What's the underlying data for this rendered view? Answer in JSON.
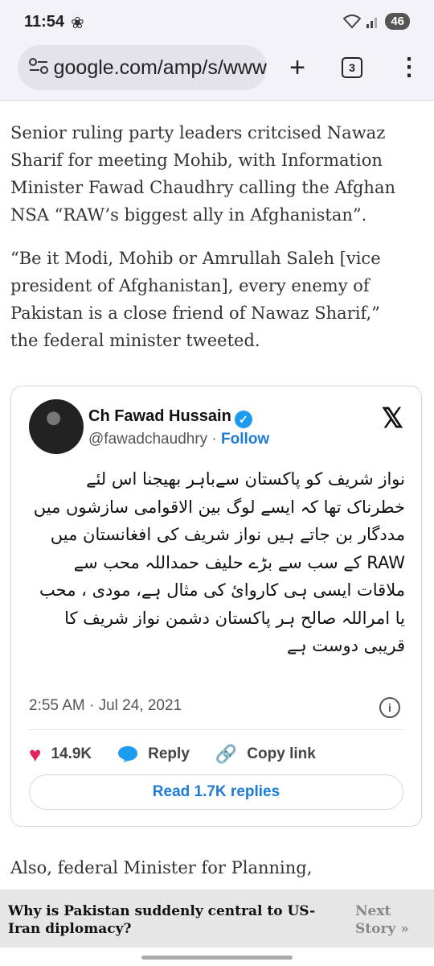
{
  "status_bar": {
    "time": "11:54",
    "battery": "46"
  },
  "browser": {
    "url": "google.com/amp/s/www",
    "tab_count": "3"
  },
  "article": {
    "paragraphs": [
      "Senior ruling party leaders critcised Nawaz Sharif for meeting Mohib, with Information Minister Fawad Chaudhry calling the Afghan NSA “RAW’s biggest ally in Afghanistan”.",
      "“Be it Modi, Mohib or Amrullah Saleh [vice president of Afghanistan], every enemy of Pakistan is a close friend of Nawaz Sharif,” the federal minister tweeted."
    ],
    "continuation": "Also, federal Minister for Planning,"
  },
  "tweet": {
    "author_name": "Ch Fawad Hussain",
    "handle": "@fawadchaudhry",
    "separator": " · ",
    "follow_label": "Follow",
    "text": "نواز شریف کو پاکستان سےباہر بھیجنا اس لئے خطرناک تھا کہ ایسے لوگ بین الاقوامی سازشوں میں مددگار بن جاتے ہیں نواز شریف کی افغانستان میں RAW کے سب سے بڑے حلیف حمداللہ محب سے ملاقات ایسی ہی کاروائ کی مثال ہے، مودی ، محب یا امراللہ صالح ہر پاکستان دشمن نواز شریف کا قریبی دوست ہے",
    "timestamp": "2:55 AM · Jul 24, 2021",
    "likes": "14.9K",
    "reply_label": "Reply",
    "copy_link_label": "Copy link",
    "read_replies_label": "Read 1.7K replies",
    "colors": {
      "like": "#e0245e",
      "link": "#1d7bd6",
      "verified": "#1d9bf0"
    }
  },
  "next_story": {
    "title": "Why is Pakistan suddenly central to US-Iran diplomacy?",
    "link_label": "Next Story »"
  }
}
